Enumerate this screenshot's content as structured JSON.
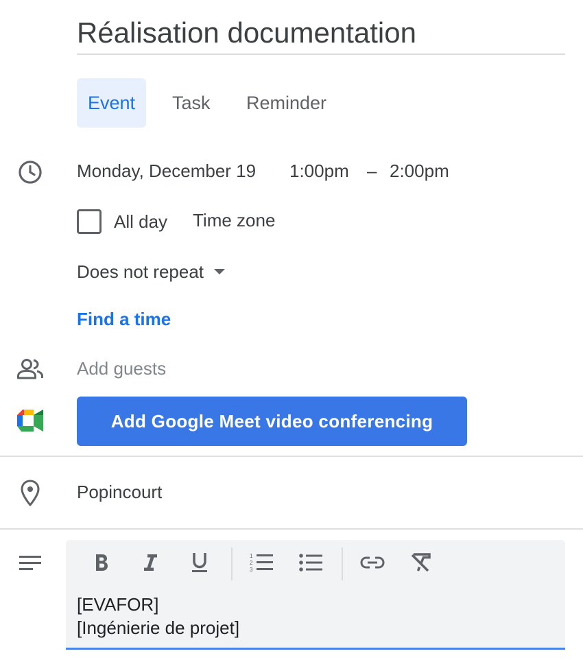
{
  "event": {
    "title": "Réalisation documentation"
  },
  "tabs": [
    {
      "label": "Event",
      "active": true
    },
    {
      "label": "Task",
      "active": false
    },
    {
      "label": "Reminder",
      "active": false
    }
  ],
  "datetime": {
    "date": "Monday, December 19",
    "start": "1:00pm",
    "separator": "–",
    "end": "2:00pm"
  },
  "all_day": {
    "label": "All day",
    "checked": false
  },
  "time_zone_label": "Time zone",
  "repeat": {
    "selected": "Does not repeat"
  },
  "find_time_label": "Find a time",
  "guests": {
    "placeholder": "Add guests"
  },
  "meet_button_label": "Add Google Meet video conferencing",
  "location": "Popincourt",
  "description": {
    "line1": "[EVAFOR]",
    "line2": "[Ingénierie de projet]"
  },
  "toolbar": [
    "bold-icon",
    "italic-icon",
    "underline-icon",
    "numbered-list-icon",
    "bulleted-list-icon",
    "link-icon",
    "clear-formatting-icon"
  ],
  "icons": {
    "time": "clock-icon",
    "guests": "people-icon",
    "meet": "google-meet-icon",
    "location": "location-pin-icon",
    "description": "notes-icon"
  },
  "colors": {
    "accent": "#1a73e8",
    "button": "#3a77e6",
    "tab_active_bg": "#e8f0fe",
    "text": "#3c4043",
    "editor_bg": "#f1f3f4"
  }
}
